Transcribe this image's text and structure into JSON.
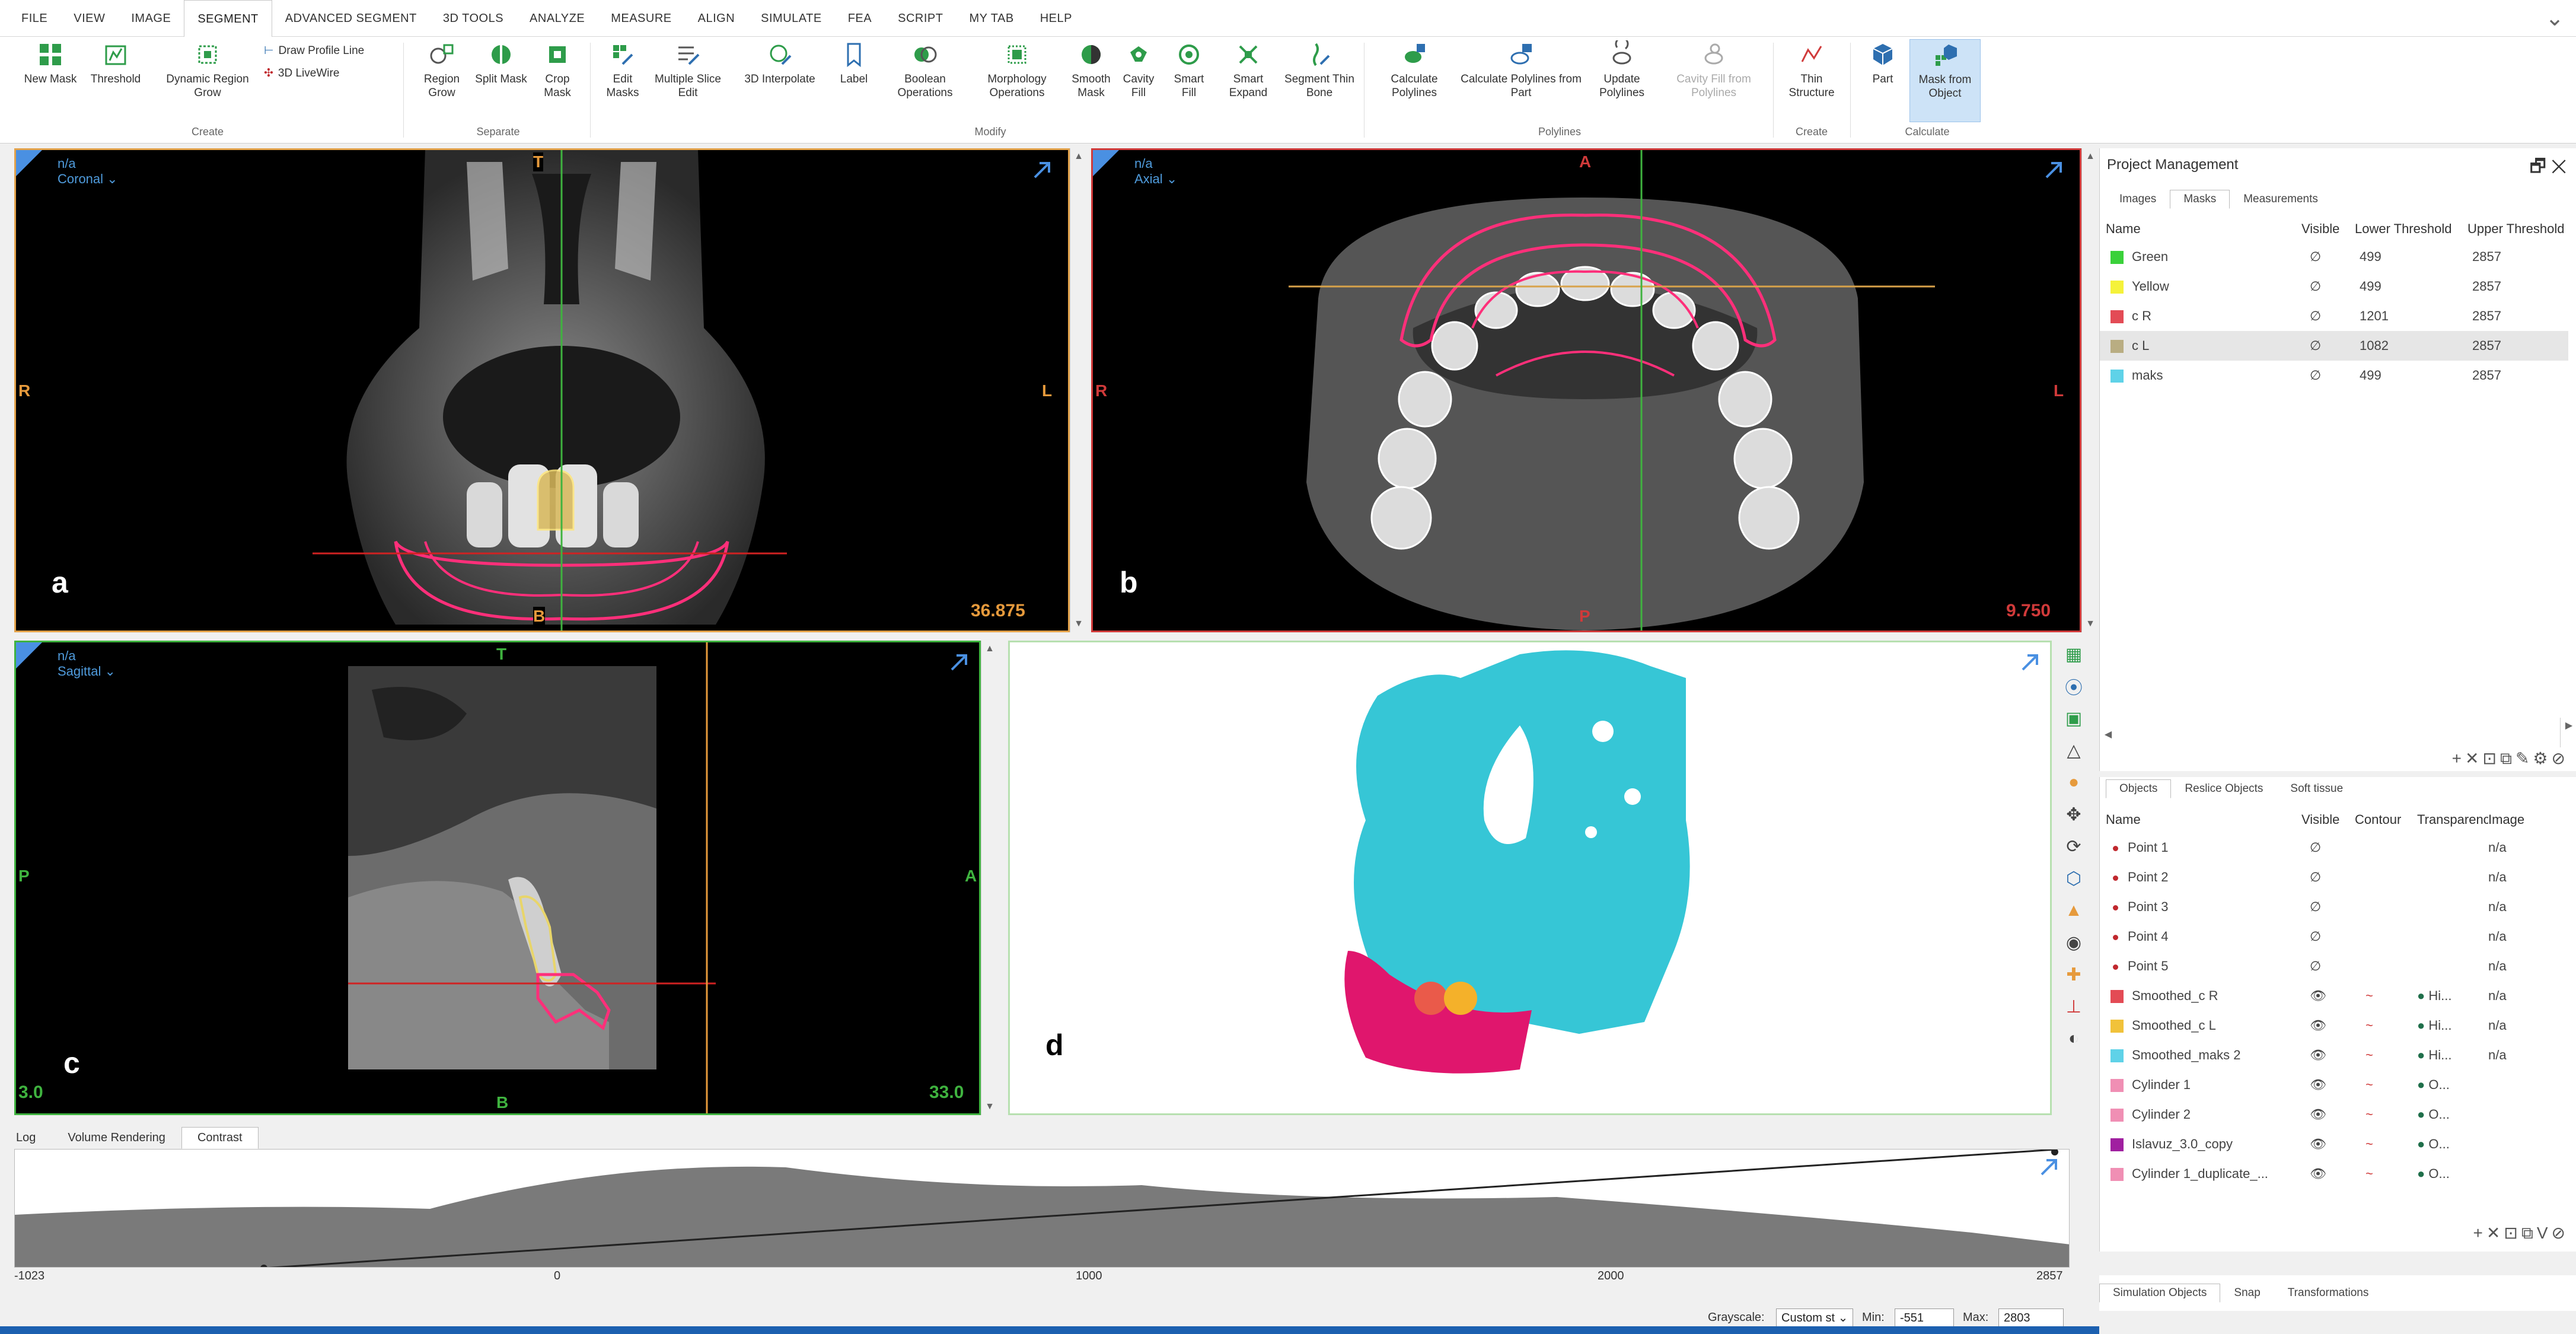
{
  "menu": {
    "items": [
      "FILE",
      "VIEW",
      "IMAGE",
      "SEGMENT",
      "ADVANCED SEGMENT",
      "3D TOOLS",
      "ANALYZE",
      "MEASURE",
      "ALIGN",
      "SIMULATE",
      "FEA",
      "SCRIPT",
      "MY TAB",
      "HELP"
    ],
    "active": "SEGMENT"
  },
  "ribbon": {
    "create": {
      "label": "Create",
      "new_mask": "New Mask",
      "threshold": "Threshold",
      "dynamic_region_grow": "Dynamic Region Grow",
      "draw_profile_line": "Draw Profile Line",
      "livewire": "3D LiveWire"
    },
    "separate": {
      "label": "Separate",
      "region_grow": "Region Grow",
      "split_mask": "Split Mask",
      "crop_mask": "Crop Mask"
    },
    "modify": {
      "label": "Modify",
      "edit_masks": "Edit Masks",
      "multiple_slice_edit": "Multiple Slice Edit",
      "interpolate_3d": "3D Interpolate",
      "label_btn": "Label",
      "boolean_operations": "Boolean Operations",
      "morphology_operations": "Morphology Operations",
      "smooth_mask": "Smooth Mask",
      "cavity_fill": "Cavity Fill",
      "smart_fill": "Smart Fill",
      "smart_expand": "Smart Expand",
      "segment_thin_bone": "Segment Thin Bone"
    },
    "polylines": {
      "label": "Polylines",
      "calculate_polylines": "Calculate Polylines",
      "calculate_polylines_from_part": "Calculate Polylines from Part",
      "update_polylines": "Update Polylines",
      "cavity_fill_from_polylines": "Cavity Fill from Polylines"
    },
    "create2": {
      "label": "Create",
      "thin_structure": "Thin Structure"
    },
    "calculate": {
      "label": "Calculate",
      "part": "Part",
      "mask_from_object": "Mask from Object"
    }
  },
  "viewports": {
    "coronal": {
      "na": "n/a",
      "view": "Coronal",
      "top": "T",
      "bottom": "B",
      "left": "R",
      "right": "L",
      "letter": "a",
      "slice": "36.875"
    },
    "axial": {
      "na": "n/a",
      "view": "Axial",
      "top": "A",
      "bottom": "P",
      "left": "R",
      "right": "L",
      "letter": "b",
      "slice": "9.750"
    },
    "sagittal": {
      "na": "n/a",
      "view": "Sagittal",
      "top": "T",
      "bottom": "B",
      "left": "P",
      "right": "A",
      "letter": "c",
      "slice": "33.0",
      "bottom_left_val": "3.0"
    },
    "three_d": {
      "letter": "d"
    }
  },
  "project_management": {
    "title": "Project Management",
    "tabs": [
      "Images",
      "Masks",
      "Measurements"
    ],
    "active_tab": "Masks",
    "columns": [
      "Name",
      "Visible",
      "Lower Threshold",
      "Upper Threshold"
    ],
    "rows": [
      {
        "name": "Green",
        "color": "#3ad13a",
        "visible": "∅",
        "lower": "499",
        "upper": "2857"
      },
      {
        "name": "Yellow",
        "color": "#f5f23a",
        "visible": "∅",
        "lower": "499",
        "upper": "2857"
      },
      {
        "name": "c R",
        "color": "#e34b55",
        "visible": "∅",
        "lower": "1201",
        "upper": "2857"
      },
      {
        "name": "c L",
        "color": "#b9ad82",
        "visible": "∅",
        "lower": "1082",
        "upper": "2857"
      },
      {
        "name": "maks",
        "color": "#5fd2e8",
        "visible": "∅",
        "lower": "499",
        "upper": "2857"
      }
    ],
    "selected_index": 3
  },
  "objects_panel": {
    "tabs": [
      "Objects",
      "Reslice Objects",
      "Soft tissue"
    ],
    "active_tab": "Objects",
    "columns": [
      "Name",
      "Visible",
      "Contour",
      "Transparency",
      "Image"
    ],
    "rows": [
      {
        "name": "Point 1",
        "kind": "point",
        "visible": "∅",
        "contour": "",
        "transp": "",
        "image": "n/a"
      },
      {
        "name": "Point 2",
        "kind": "point",
        "visible": "∅",
        "contour": "",
        "transp": "",
        "image": "n/a"
      },
      {
        "name": "Point 3",
        "kind": "point",
        "visible": "∅",
        "contour": "",
        "transp": "",
        "image": "n/a"
      },
      {
        "name": "Point 4",
        "kind": "point",
        "visible": "∅",
        "contour": "",
        "transp": "",
        "image": "n/a"
      },
      {
        "name": "Point 5",
        "kind": "point",
        "visible": "∅",
        "contour": "",
        "transp": "",
        "image": "n/a"
      },
      {
        "name": "Smoothed_c R",
        "kind": "swatch",
        "color": "#e34b55",
        "visible": "👁",
        "contour": "~",
        "transp": "Hi...",
        "image": "n/a"
      },
      {
        "name": "Smoothed_c L",
        "kind": "swatch",
        "color": "#f1c23a",
        "visible": "👁",
        "contour": "~",
        "transp": "Hi...",
        "image": "n/a"
      },
      {
        "name": "Smoothed_maks 2",
        "kind": "swatch",
        "color": "#5fd2e8",
        "visible": "👁",
        "contour": "~",
        "transp": "Hi...",
        "image": "n/a"
      },
      {
        "name": "Cylinder 1",
        "kind": "swatch",
        "color": "#f08fb4",
        "visible": "👁",
        "contour": "~",
        "transp": "O...",
        "image": ""
      },
      {
        "name": "Cylinder 2",
        "kind": "swatch",
        "color": "#f08fb4",
        "visible": "👁",
        "contour": "~",
        "transp": "O...",
        "image": ""
      },
      {
        "name": "Islavuz_3.0_copy",
        "kind": "swatch",
        "color": "#a020a0",
        "visible": "👁",
        "contour": "~",
        "transp": "O...",
        "image": ""
      },
      {
        "name": "Cylinder 1_duplicate_...",
        "kind": "swatch",
        "color": "#f08fb4",
        "visible": "👁",
        "contour": "~",
        "transp": "O...",
        "image": ""
      }
    ]
  },
  "bottom_tabs": [
    "Log",
    "Volume Rendering",
    "Contrast"
  ],
  "bottom_active": "Contrast",
  "histogram": {
    "ticks": [
      "-1023",
      "0",
      "1000",
      "2000",
      "2857"
    ]
  },
  "status": {
    "grayscale_label": "Grayscale:",
    "grayscale_value": "Custom st",
    "min_label": "Min:",
    "min_value": "-551",
    "max_label": "Max:",
    "max_value": "2803"
  },
  "sim_tabs": [
    "Simulation Objects",
    "Snap",
    "Transformations"
  ]
}
